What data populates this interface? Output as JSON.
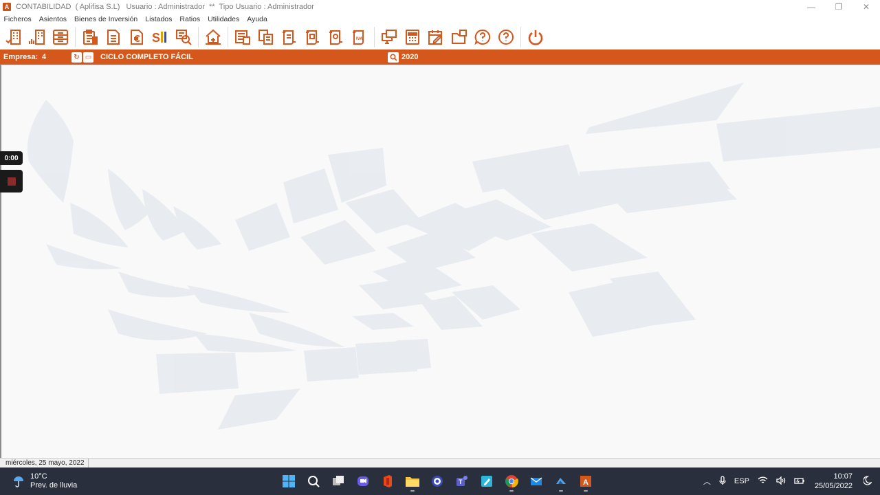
{
  "window": {
    "title": "CONTABILIDAD  ( Aplifisa S.L)   Usuario : Administrador  **  Tipo Usuario : Administrador",
    "app_icon_glyph": "A",
    "minimize": "—",
    "restore": "❐",
    "close": "✕"
  },
  "menu": [
    "Ficheros",
    "Asientos",
    "Bienes de Inversión",
    "Listados",
    "Ratios",
    "Utilidades",
    "Ayuda"
  ],
  "toolbar": {
    "accent_color": "#d4571c",
    "groups": [
      [
        "building-check-icon",
        "building-chart-icon",
        "drawer-icon"
      ],
      [
        "clipboard-list-icon",
        "document-icon",
        "document-euro-icon",
        "sii-icon",
        "search-report-icon"
      ],
      [
        "balance-home-icon"
      ],
      [
        "ledger-icon",
        "copy-document-icon",
        "journal-icon",
        "journal-2-icon",
        "journal-3-icon",
        "iva-book-icon"
      ],
      [
        "monitor-icon",
        "calculator-icon",
        "calendar-edit-icon",
        "folder-export-icon",
        "help-chat-icon",
        "help-icon"
      ],
      [
        "power-icon"
      ]
    ],
    "sii_label": "SII"
  },
  "infobar": {
    "empresa_label": "Empresa:",
    "empresa_value": "4",
    "company_name": "CICLO COMPLETO FÁCIL",
    "year": "2020"
  },
  "recorder": {
    "timer": "0:00"
  },
  "status": {
    "date": "miércoles, 25 mayo, 2022"
  },
  "taskbar": {
    "weather_temp": "10°C",
    "weather_desc": "Prev. de lluvia",
    "language": "ESP",
    "time": "10:07",
    "date": "25/05/2022",
    "apps": [
      "windows-start-icon",
      "search-icon",
      "task-view-icon",
      "teams-chat-icon",
      "office-icon",
      "file-explorer-icon",
      "settings-icon",
      "teams-icon",
      "notepad-icon",
      "chrome-icon",
      "mail-icon",
      "onedrive-icon",
      "contabilidad-app-icon"
    ]
  }
}
